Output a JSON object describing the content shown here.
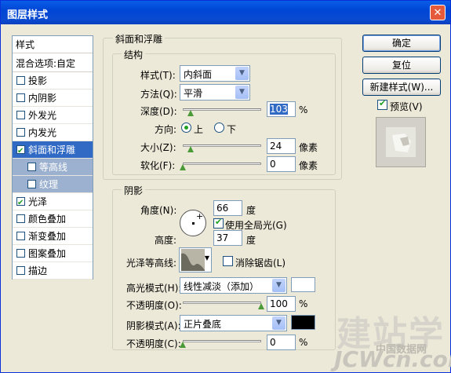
{
  "window": {
    "title": "图层样式",
    "close_glyph": "✕"
  },
  "sidebar": {
    "header1": "样式",
    "header2": "混合选项:自定",
    "items": [
      {
        "label": "投影",
        "checked": false
      },
      {
        "label": "内阴影",
        "checked": false
      },
      {
        "label": "外发光",
        "checked": false
      },
      {
        "label": "内发光",
        "checked": false
      },
      {
        "label": "斜面和浮雕",
        "checked": true
      },
      {
        "label": "等高线",
        "checked": false
      },
      {
        "label": "纹理",
        "checked": false
      },
      {
        "label": "光泽",
        "checked": true
      },
      {
        "label": "颜色叠加",
        "checked": false
      },
      {
        "label": "渐变叠加",
        "checked": false
      },
      {
        "label": "图案叠加",
        "checked": false
      },
      {
        "label": "描边",
        "checked": false
      }
    ]
  },
  "bevel": {
    "title": "斜面和浮雕",
    "structure_title": "结构",
    "style_label": "样式(T):",
    "style_value": "内斜面",
    "technique_label": "方法(Q):",
    "technique_value": "平滑",
    "depth_label": "深度(D):",
    "depth_value": "103",
    "depth_unit": "%",
    "depth_level": 0.103,
    "direction_label": "方向:",
    "dir_up": "上",
    "dir_down": "下",
    "direction_selected": "上",
    "size_label": "大小(Z):",
    "size_value": "24",
    "size_unit": "像素",
    "size_level": 0.1,
    "soften_label": "软化(F):",
    "soften_value": "0",
    "soften_unit": "像素",
    "soften_level": 0
  },
  "shading": {
    "title": "阴影",
    "angle_label": "角度(N):",
    "angle_value": "66",
    "angle_unit": "度",
    "global_light_label": "使用全局光(G)",
    "global_light": true,
    "altitude_label": "高度:",
    "altitude_value": "37",
    "altitude_unit": "度",
    "gloss_label": "光泽等高线:",
    "antialias_label": "消除锯齿(L)",
    "antialias": false,
    "highlight_mode_label": "高光模式(H):",
    "highlight_mode_value": "线性减淡（添加）",
    "highlight_color": "#ffffff",
    "highlight_opacity_label": "不透明度(O):",
    "highlight_opacity_value": "100",
    "highlight_opacity_unit": "%",
    "highlight_opacity_level": 1.0,
    "shadow_mode_label": "阴影模式(A):",
    "shadow_mode_value": "正片叠底",
    "shadow_color": "#000000",
    "shadow_opacity_label": "不透明度(C):",
    "shadow_opacity_value": "0",
    "shadow_opacity_unit": "%",
    "shadow_opacity_level": 0
  },
  "buttons": {
    "ok": "确定",
    "reset": "复位",
    "new_style": "新建样式(W)...",
    "preview_label": "预览(V)",
    "preview": true
  },
  "watermark": {
    "brand": "建站学",
    "sub": "中国数据网",
    "url": "JCWcn.com"
  }
}
